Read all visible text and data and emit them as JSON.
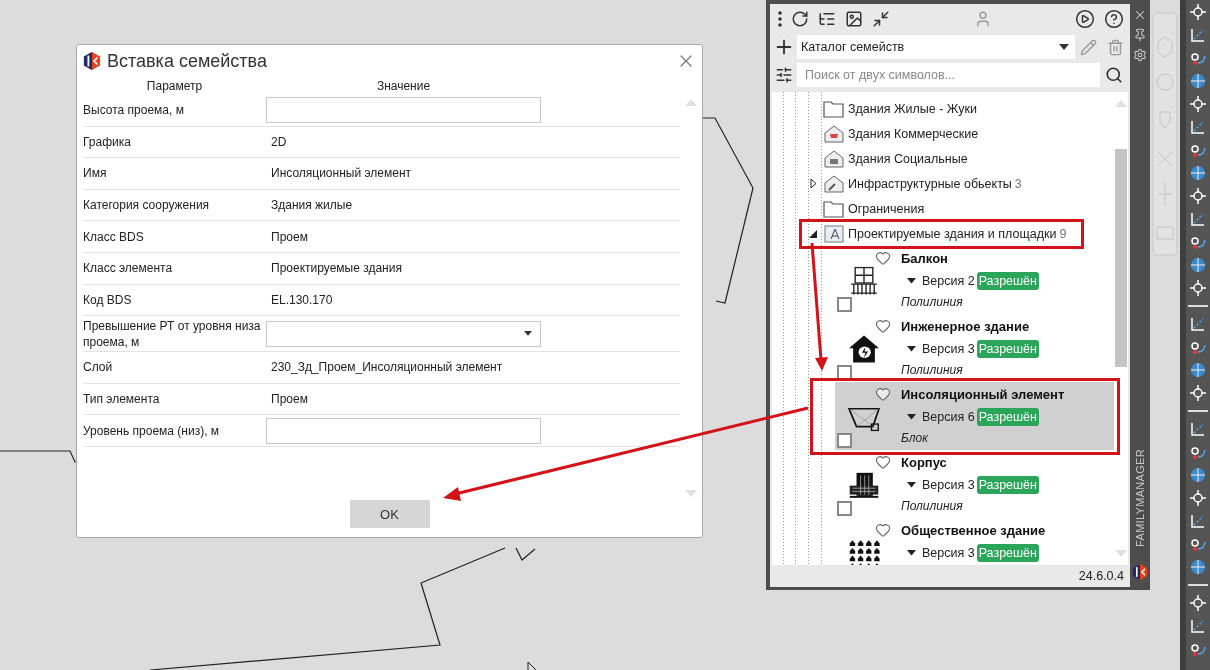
{
  "dialog": {
    "title": "Вставка семейства",
    "columns": [
      "Параметр",
      "Значение"
    ],
    "rows": [
      {
        "kind": "input",
        "label": "Высота проема, м"
      },
      {
        "kind": "text",
        "label": "Графика",
        "value": "2D"
      },
      {
        "kind": "text",
        "label": "Имя",
        "value": "Инсоляционный элемент"
      },
      {
        "kind": "text",
        "label": "Категория сооружения",
        "value": "Здания жилые"
      },
      {
        "kind": "text",
        "label": "Класс BDS",
        "value": "Проем"
      },
      {
        "kind": "text",
        "label": "Класс элемента",
        "value": "Проектируемые здания"
      },
      {
        "kind": "text",
        "label": "Код BDS",
        "value": "EL.130.170"
      },
      {
        "kind": "select",
        "label": "Превышение РТ от уровня низа проема, м"
      },
      {
        "kind": "text",
        "label": "Слой",
        "value": "230_Зд_Проем_Инсоляционный элемент"
      },
      {
        "kind": "text",
        "label": "Тип элемента",
        "value": "Проем"
      },
      {
        "kind": "input",
        "label": "Уровень проема (низ), м"
      }
    ],
    "ok_button": "OK"
  },
  "panel": {
    "catalog": "Каталог семейств",
    "search": {
      "placeholder": "Поиск от двух символов..."
    },
    "tree": [
      {
        "kind": "folder",
        "label": "Здания Жилые - Жуки",
        "highlighted": false
      },
      {
        "kind": "commercial",
        "label": "Здания Коммерческие",
        "highlighted": false
      },
      {
        "kind": "social",
        "label": "Здания Социальные",
        "highlighted": false
      },
      {
        "kind": "infrastructure",
        "label": "Инфраструктурные обьекты",
        "count": "3",
        "expanded": false,
        "highlighted": false
      },
      {
        "kind": "folder",
        "label": "Ограничения",
        "highlighted": false
      },
      {
        "kind": "project",
        "label": "Проектируемые здания и площадки",
        "count": "9",
        "expanded": true,
        "highlighted": true,
        "families": [
          {
            "kind": "balcony",
            "name": "Балкон",
            "version": "Версия 2",
            "status": "Разрешён",
            "type": "Полилиния",
            "selected": false,
            "highlighted": false,
            "favorite": false,
            "checked": false
          },
          {
            "kind": "engineering",
            "name": "Инженерное здание",
            "version": "Версия 3",
            "status": "Разрешён",
            "type": "Полилиния",
            "selected": false,
            "highlighted": false,
            "favorite": false,
            "checked": false
          },
          {
            "kind": "insolation",
            "name": "Инсоляционный элемент",
            "version": "Версия 6",
            "status": "Разрешён",
            "type": "Блок",
            "selected": true,
            "highlighted": true,
            "favorite": false,
            "checked": false
          },
          {
            "kind": "tower",
            "name": "Корпус",
            "version": "Версия 3",
            "status": "Разрешён",
            "type": "Полилиния",
            "selected": false,
            "highlighted": false,
            "favorite": false,
            "checked": false
          },
          {
            "kind": "public",
            "name": "Общественное здание",
            "version": "Версия 3",
            "status": "Разрешён",
            "selected": false,
            "highlighted": false,
            "favorite": false
          }
        ]
      }
    ],
    "version": "24.6.0.4",
    "side_title": "FAMILYMANAGER"
  }
}
